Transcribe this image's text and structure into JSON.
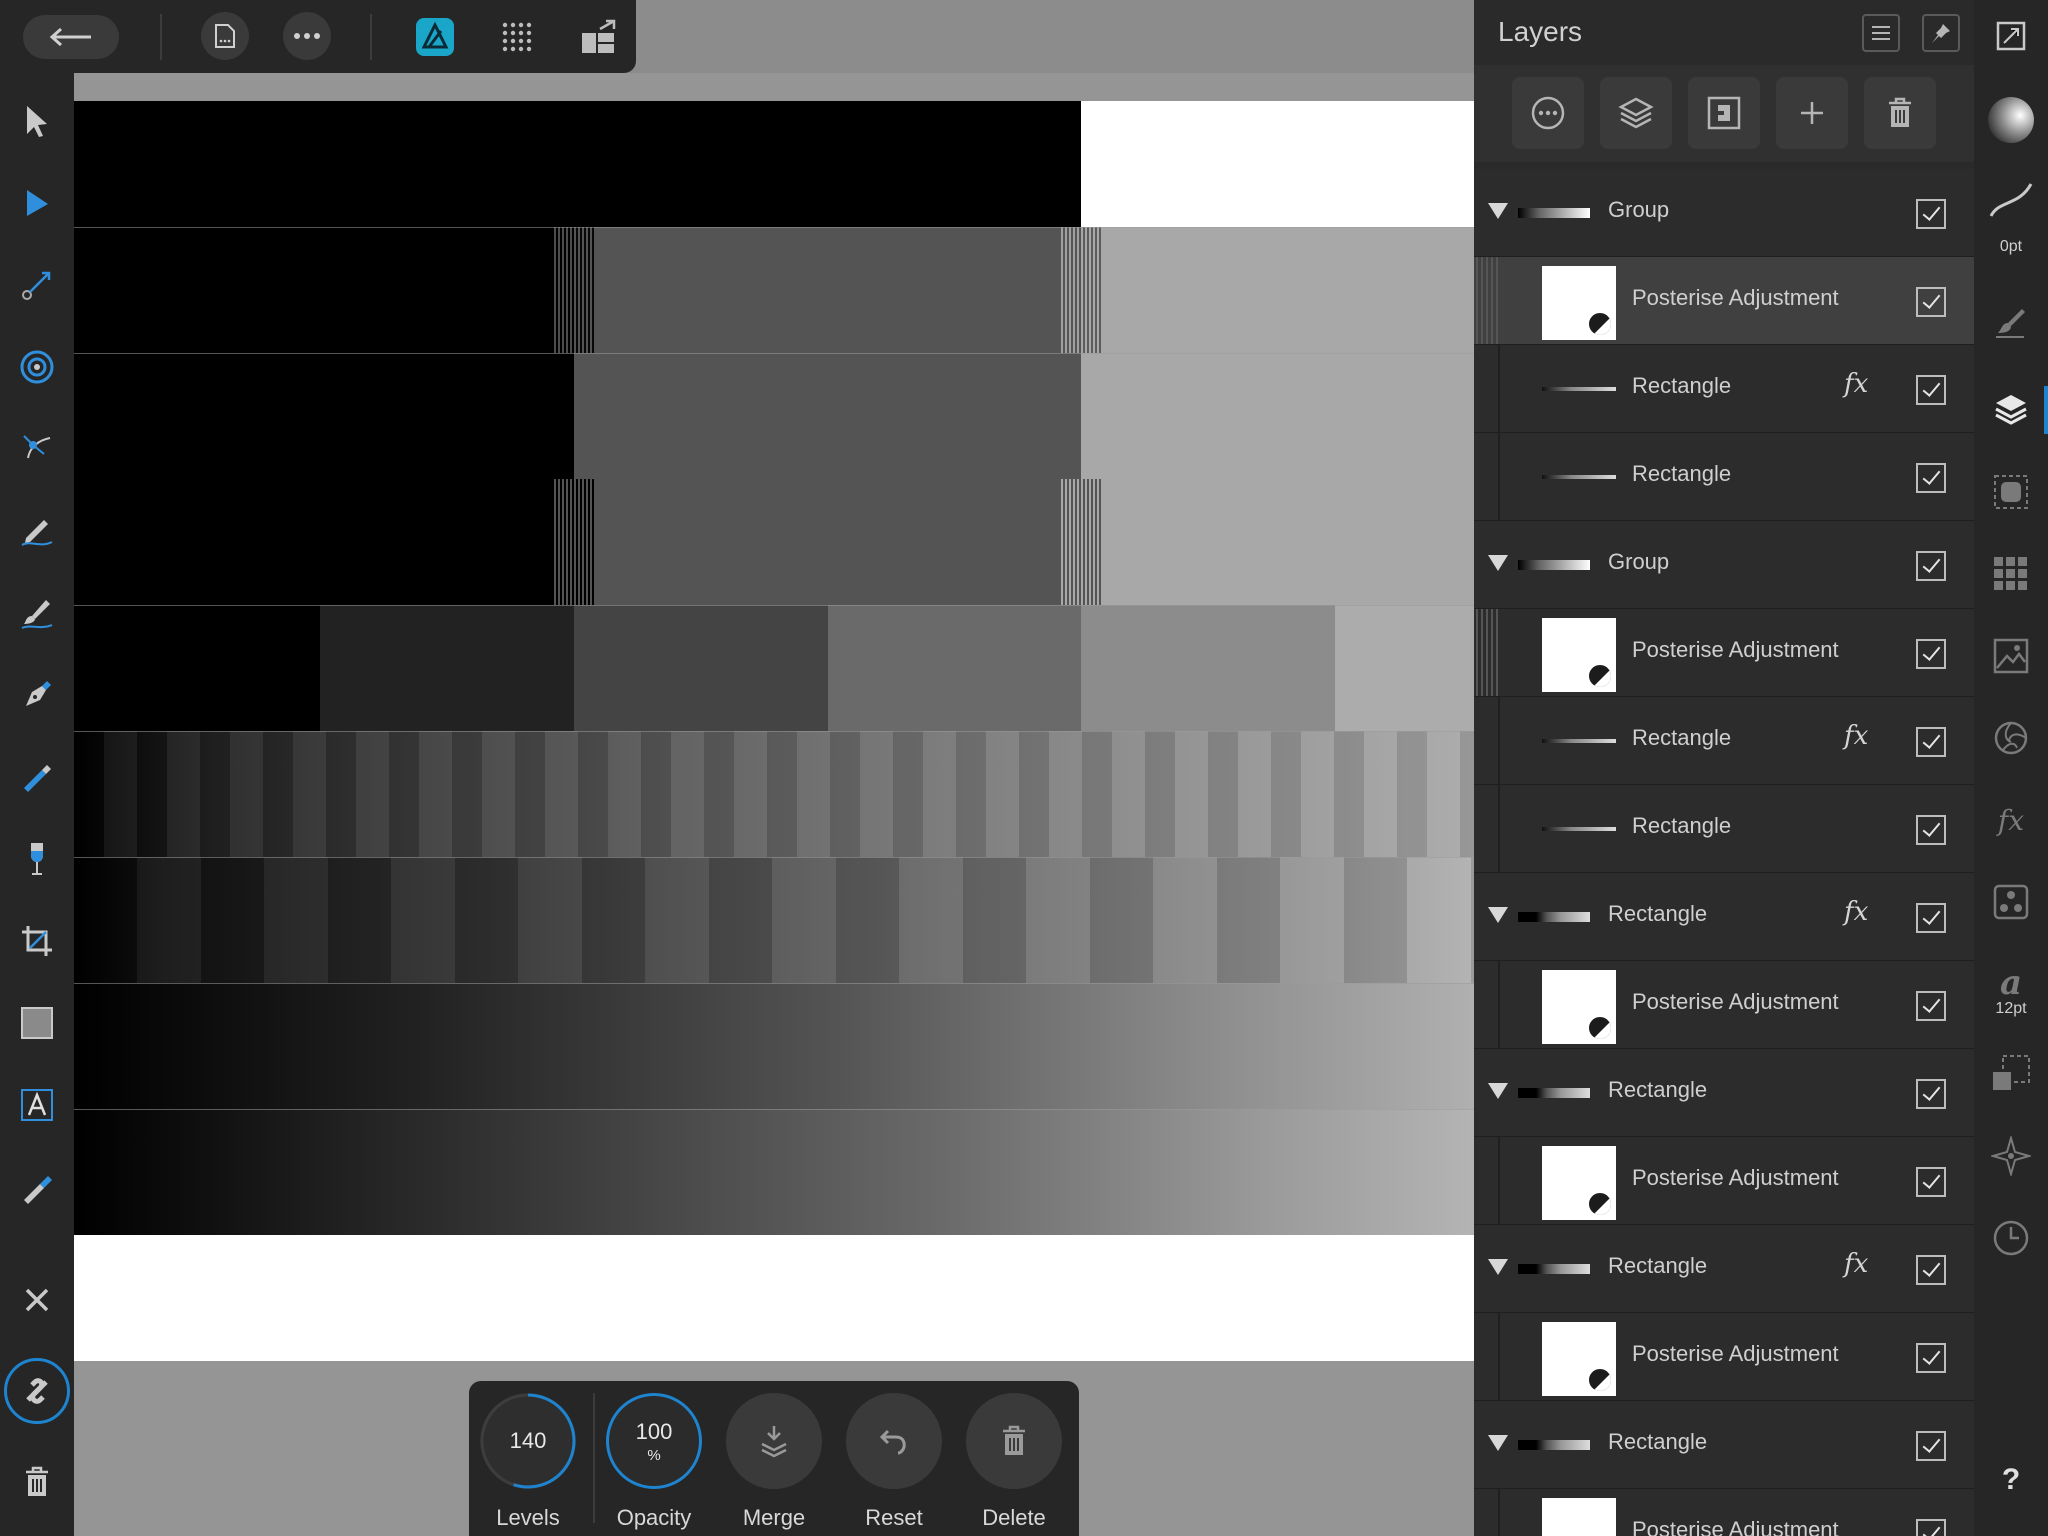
{
  "context_toolbar": {
    "levels": {
      "value": "140",
      "label": "Levels",
      "fraction": 0.55
    },
    "opacity": {
      "value": "100",
      "unit": "%",
      "label": "Opacity",
      "fraction": 1.0
    },
    "merge": {
      "label": "Merge"
    },
    "reset": {
      "label": "Reset"
    },
    "delete": {
      "label": "Delete"
    }
  },
  "layers_panel": {
    "title": "Layers",
    "rows": [
      {
        "name": "Group",
        "kind": "group",
        "expanded": true,
        "fx": false,
        "checked": true
      },
      {
        "name": "Posterise Adjustment",
        "kind": "adjustment",
        "fx": false,
        "checked": true,
        "selected": true
      },
      {
        "name": "Rectangle",
        "kind": "child",
        "fx": true,
        "checked": true
      },
      {
        "name": "Rectangle",
        "kind": "child",
        "fx": false,
        "checked": true
      },
      {
        "name": "Group",
        "kind": "group",
        "expanded": true,
        "fx": false,
        "checked": true
      },
      {
        "name": "Posterise Adjustment",
        "kind": "adjustment",
        "fx": false,
        "checked": true
      },
      {
        "name": "Rectangle",
        "kind": "child",
        "fx": true,
        "checked": true
      },
      {
        "name": "Rectangle",
        "kind": "child",
        "fx": false,
        "checked": true
      },
      {
        "name": "Rectangle",
        "kind": "top",
        "expanded": true,
        "fx": true,
        "checked": true
      },
      {
        "name": "Posterise Adjustment",
        "kind": "adjustment",
        "fx": false,
        "checked": true
      },
      {
        "name": "Rectangle",
        "kind": "top",
        "expanded": true,
        "fx": false,
        "checked": true
      },
      {
        "name": "Posterise Adjustment",
        "kind": "adjustment",
        "fx": false,
        "checked": true
      },
      {
        "name": "Rectangle",
        "kind": "top",
        "expanded": true,
        "fx": true,
        "checked": true
      },
      {
        "name": "Posterise Adjustment",
        "kind": "adjustment",
        "fx": false,
        "checked": true
      },
      {
        "name": "Rectangle",
        "kind": "top",
        "expanded": true,
        "fx": false,
        "checked": true
      },
      {
        "name": "Posterise Adjustment",
        "kind": "adjustment",
        "fx": false,
        "checked": true
      }
    ]
  },
  "studio": {
    "stroke_width": "0pt",
    "font_size": "12pt",
    "help": "?"
  },
  "fx_glyph": "fx",
  "colors": {
    "accent": "#1e84d0",
    "panel": "#2a2a2a",
    "toolbar": "#262626",
    "canvas_bg": "#959595"
  }
}
